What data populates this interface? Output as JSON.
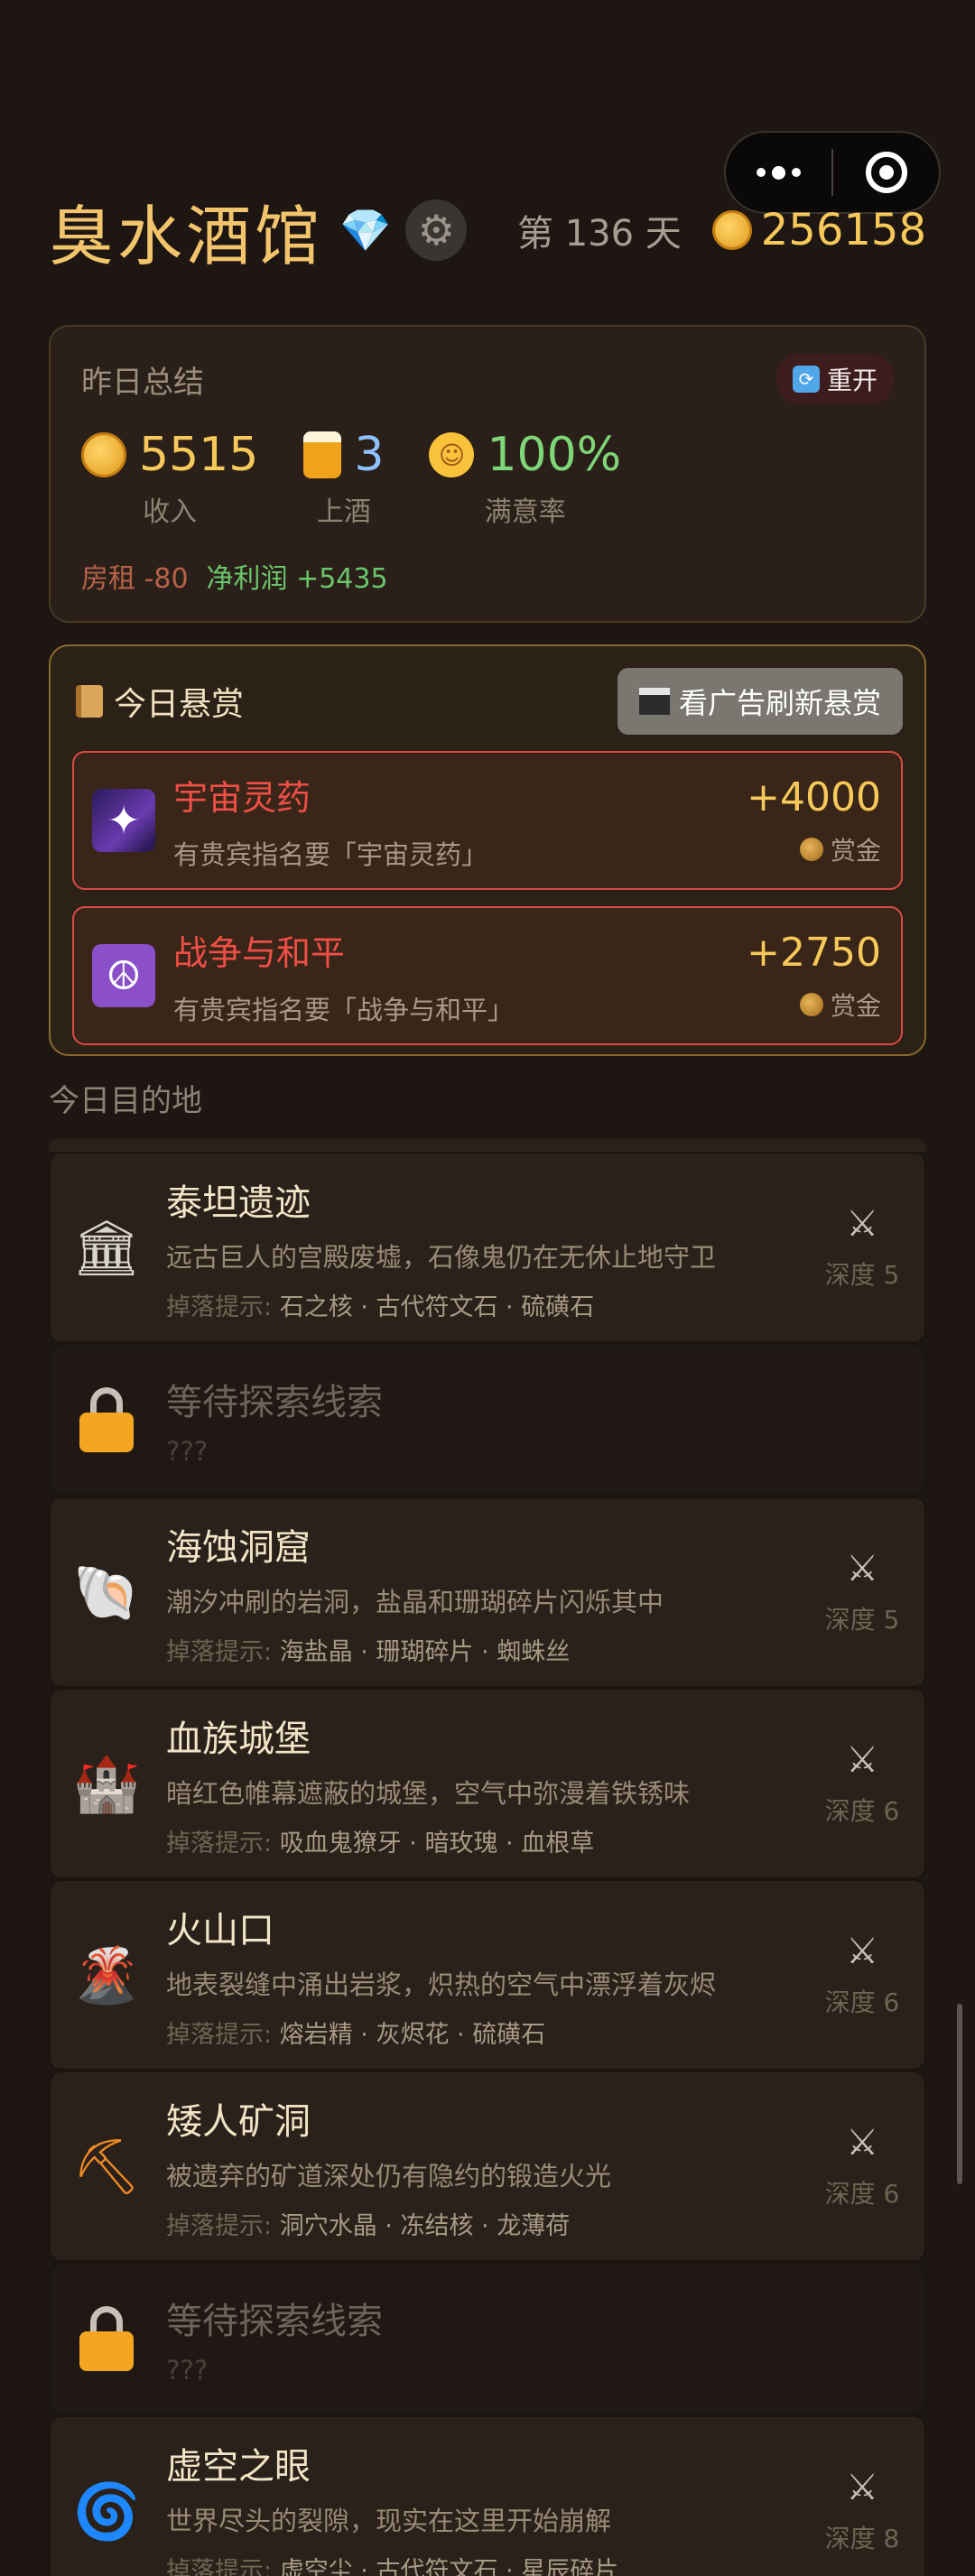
{
  "header": {
    "title": "臭水酒馆",
    "day": "第 136 天",
    "gold": "256158"
  },
  "summary": {
    "title": "昨日总结",
    "reopen": "重开",
    "income": "5515",
    "income_label": "收入",
    "served": "3",
    "served_label": "上酒",
    "satisfaction": "100%",
    "satisfaction_label": "满意率",
    "rent": "房租 -80",
    "net_profit": "净利润 +5435"
  },
  "bounty": {
    "title": "今日悬赏",
    "refresh_button": "看广告刷新悬赏",
    "items": [
      {
        "name": "宇宙灵药",
        "desc": "有贵宾指名要「宇宙灵药」",
        "amount": "+4000",
        "label": "赏金"
      },
      {
        "name": "战争与和平",
        "desc": "有贵宾指名要「战争与和平」",
        "amount": "+2750",
        "label": "赏金"
      }
    ]
  },
  "destinations_title": "今日目的地",
  "destinations": [
    {
      "name": "泰坦遗迹",
      "desc": "远古巨人的宫殿废墟，石像鬼仍在无休止地守卫",
      "hint_label": "掉落提示:",
      "drops": "石之核 · 古代符文石 · 硫磺石",
      "depth": "深度 5",
      "icon": "classical-building-icon"
    },
    {
      "name": "等待探索线索",
      "desc": "???",
      "locked": true
    },
    {
      "name": "海蚀洞窟",
      "desc": "潮汐冲刷的岩洞，盐晶和珊瑚碎片闪烁其中",
      "hint_label": "掉落提示:",
      "drops": "海盐晶 · 珊瑚碎片 · 蜘蛛丝",
      "depth": "深度 5",
      "icon": "shell-icon"
    },
    {
      "name": "血族城堡",
      "desc": "暗红色帷幕遮蔽的城堡，空气中弥漫着铁锈味",
      "hint_label": "掉落提示:",
      "drops": "吸血鬼獠牙 · 暗玫瑰 · 血根草",
      "depth": "深度 6",
      "icon": "castle-icon"
    },
    {
      "name": "火山口",
      "desc": "地表裂缝中涌出岩浆，炽热的空气中漂浮着灰烬",
      "hint_label": "掉落提示:",
      "drops": "熔岩精 · 灰烬花 · 硫磺石",
      "depth": "深度 6",
      "icon": "volcano-icon"
    },
    {
      "name": "矮人矿洞",
      "desc": "被遗弃的矿道深处仍有隐约的锻造火光",
      "hint_label": "掉落提示:",
      "drops": "洞穴水晶 · 冻结核 · 龙薄荷",
      "depth": "深度 6",
      "icon": "pickaxe-icon"
    },
    {
      "name": "等待探索线索",
      "desc": "???",
      "locked": true
    },
    {
      "name": "虚空之眼",
      "desc": "世界尽头的裂隙，现实在这里开始崩解",
      "hint_label": "掉落提示:",
      "drops": "虚空尘 · 古代符文石 · 星辰碎片",
      "depth": "深度 8",
      "icon": "vortex-icon"
    }
  ]
}
